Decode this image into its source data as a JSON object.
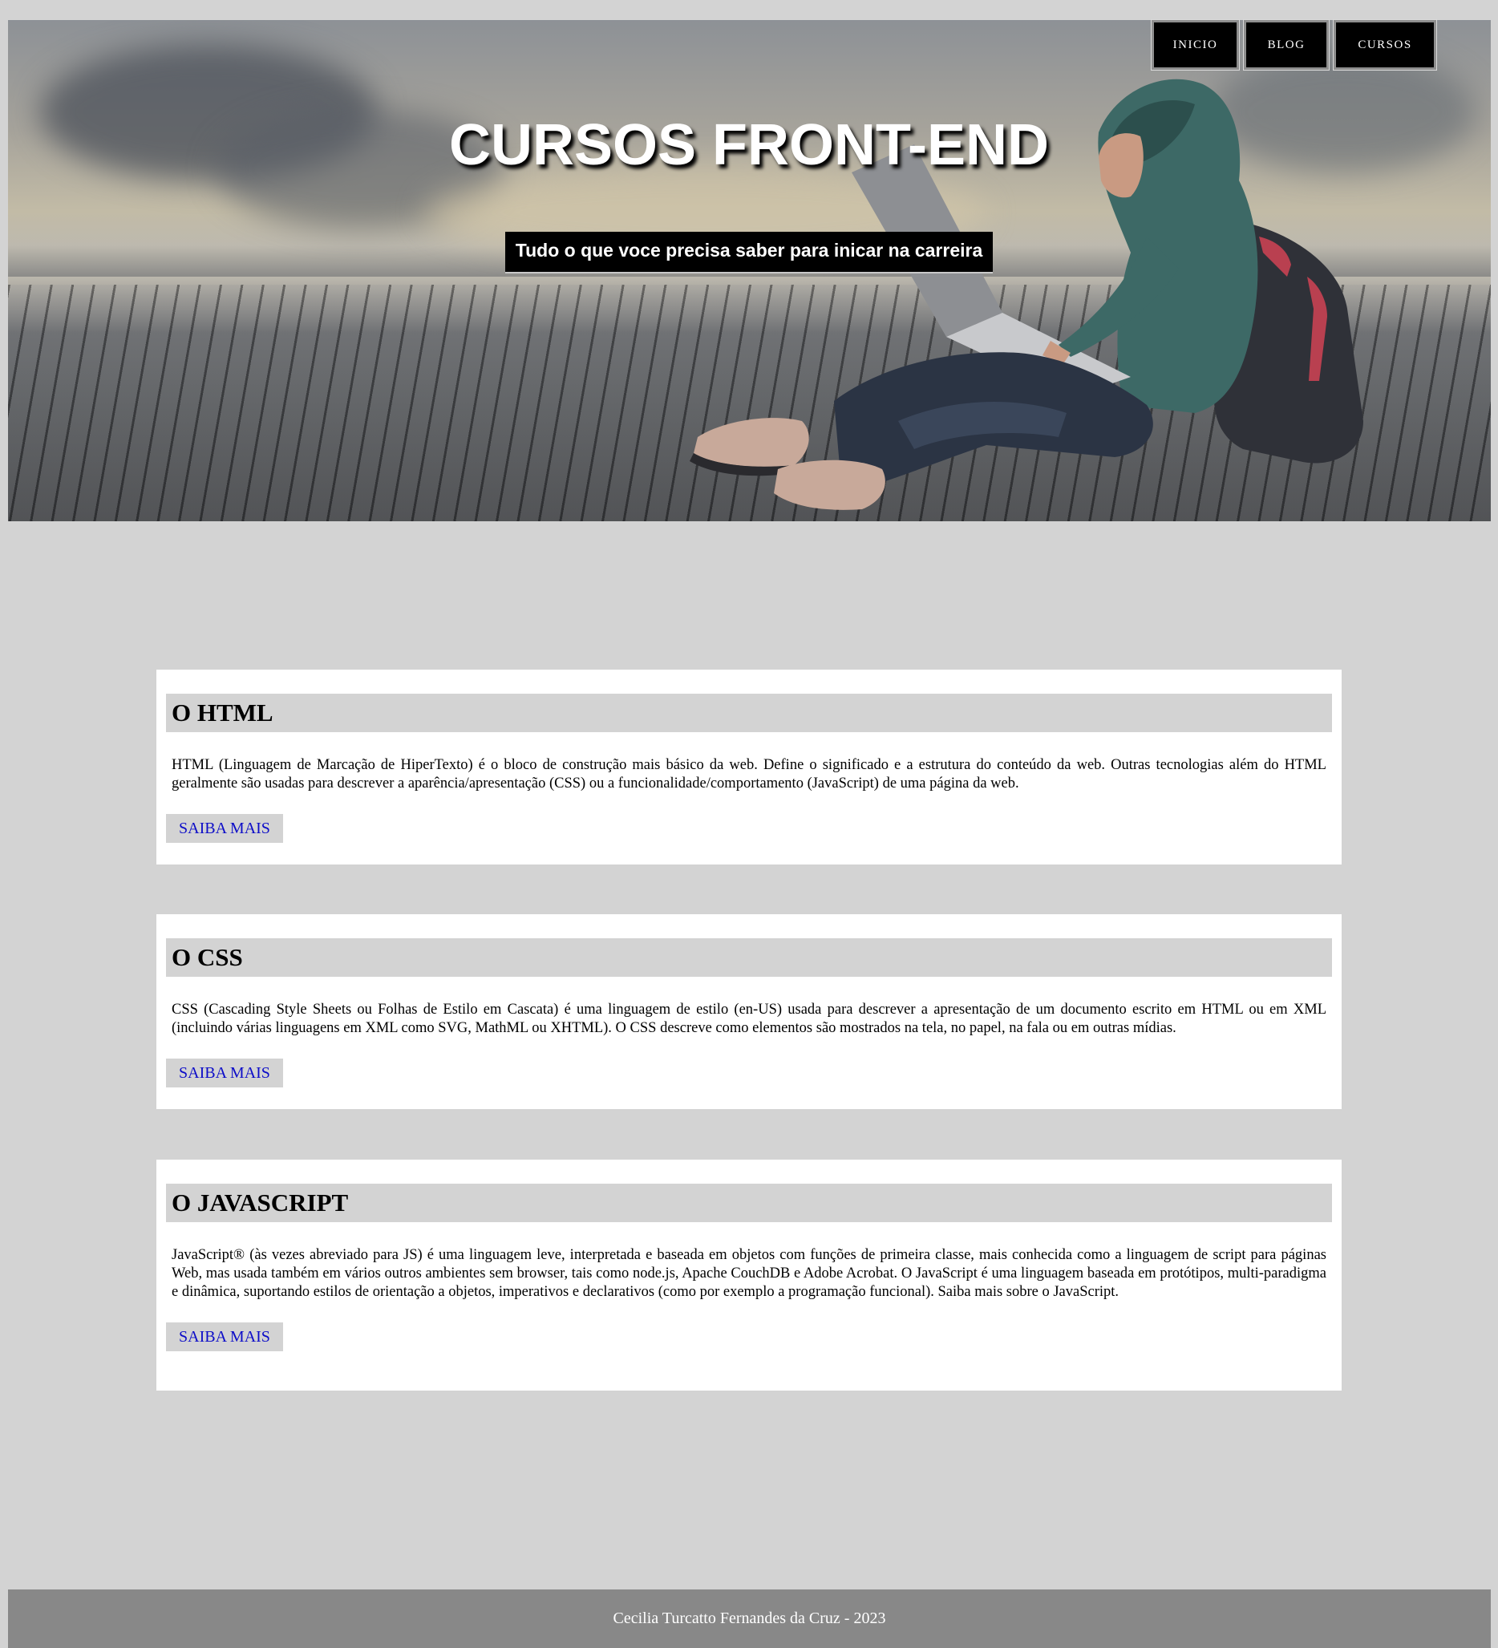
{
  "nav": {
    "items": [
      {
        "label": "INICIO"
      },
      {
        "label": "BLOG"
      },
      {
        "label": "CURSOS"
      }
    ]
  },
  "hero": {
    "title": "CURSOS FRONT-END",
    "subtitle": "Tudo o que voce precisa saber para inicar na carreira"
  },
  "cards": [
    {
      "title": "O HTML",
      "text": "HTML (Linguagem de Marcação de HiperTexto) é o bloco de construção mais básico da web. Define o significado e a estrutura do conteúdo da web. Outras tecnologias além do HTML geralmente são usadas para descrever a aparência/apresentação (CSS) ou a funcionalidade/comportamento (JavaScript) de uma página da web.",
      "button": "SAIBA MAIS"
    },
    {
      "title": "O CSS",
      "text": "CSS (Cascading Style Sheets ou Folhas de Estilo em Cascata) é uma linguagem de estilo (en-US) usada para descrever a apresentação de um documento escrito em HTML ou em XML (incluindo várias linguagens em XML como SVG, MathML ou XHTML). O CSS descreve como elementos são mostrados na tela, no papel, na fala ou em outras mídias.",
      "button": "SAIBA MAIS"
    },
    {
      "title": "O JAVASCRIPT",
      "text": "JavaScript® (às vezes abreviado para JS) é uma linguagem leve, interpretada e baseada em objetos com funções de primeira classe, mais conhecida como a linguagem de script para páginas Web, mas usada também em vários outros ambientes sem browser, tais como node.js, Apache CouchDB e Adobe Acrobat. O JavaScript é uma linguagem baseada em protótipos, multi-paradigma e dinâmica, suportando estilos de orientação a objetos, imperativos e declarativos (como por exemplo a programação funcional). Saiba mais sobre o JavaScript.",
      "button": "SAIBA MAIS"
    }
  ],
  "footer": {
    "text": "Cecilia Turcatto Fernandes da Cruz - 2023"
  },
  "colors": {
    "page_background": "#d3d3d3",
    "card_background": "#ffffff",
    "link": "#0d0dc8",
    "footer_background": "#888888"
  }
}
